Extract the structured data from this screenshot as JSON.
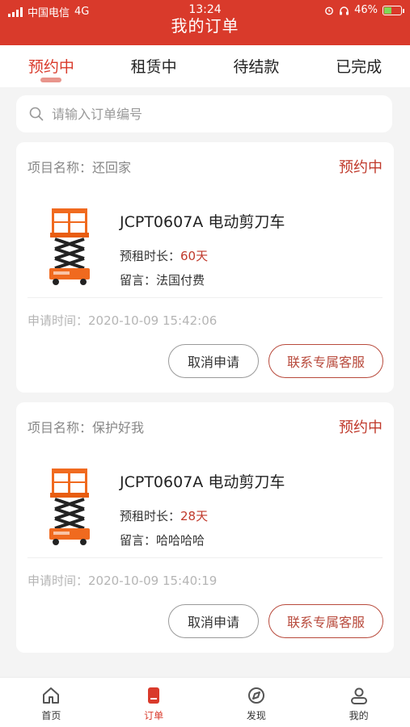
{
  "status_bar": {
    "carrier": "中国电信",
    "network": "4G",
    "time": "13:24",
    "battery": "46%",
    "battery_level": 0.46
  },
  "header": {
    "title": "我的订单"
  },
  "tabs": [
    {
      "label": "预约中",
      "active": true
    },
    {
      "label": "租赁中",
      "active": false
    },
    {
      "label": "待结款",
      "active": false
    },
    {
      "label": "已完成",
      "active": false
    }
  ],
  "search": {
    "placeholder": "请输入订单编号",
    "value": "",
    "icon": "search-icon"
  },
  "orders": [
    {
      "project_label": "项目名称：",
      "project_name": "还回家",
      "status": "预约中",
      "product_name": "JCPT0607A  电动剪刀车",
      "duration_label": "预租时长：",
      "duration_value": "60天",
      "message_label": "留言：",
      "message_value": "法国付费",
      "apply_time_label": "申请时间：",
      "apply_time_value": "2020-10-09 15:42:06",
      "cancel_label": "取消申请",
      "contact_label": "联系专属客服"
    },
    {
      "project_label": "项目名称：",
      "project_name": "保护好我",
      "status": "预约中",
      "product_name": "JCPT0607A  电动剪刀车",
      "duration_label": "预租时长：",
      "duration_value": "28天",
      "message_label": "留言：",
      "message_value": "哈哈哈哈",
      "apply_time_label": "申请时间：",
      "apply_time_value": "2020-10-09 15:40:19",
      "cancel_label": "取消申请",
      "contact_label": "联系专属客服"
    }
  ],
  "tabbar": [
    {
      "label": "首页",
      "icon": "home-icon",
      "active": false
    },
    {
      "label": "订单",
      "icon": "order-icon",
      "active": true
    },
    {
      "label": "发现",
      "icon": "discover-icon",
      "active": false
    },
    {
      "label": "我的",
      "icon": "profile-icon",
      "active": false
    }
  ],
  "colors": {
    "brand": "#d93a2b",
    "status_text": "#c0392b",
    "background": "#f4f4f4"
  }
}
